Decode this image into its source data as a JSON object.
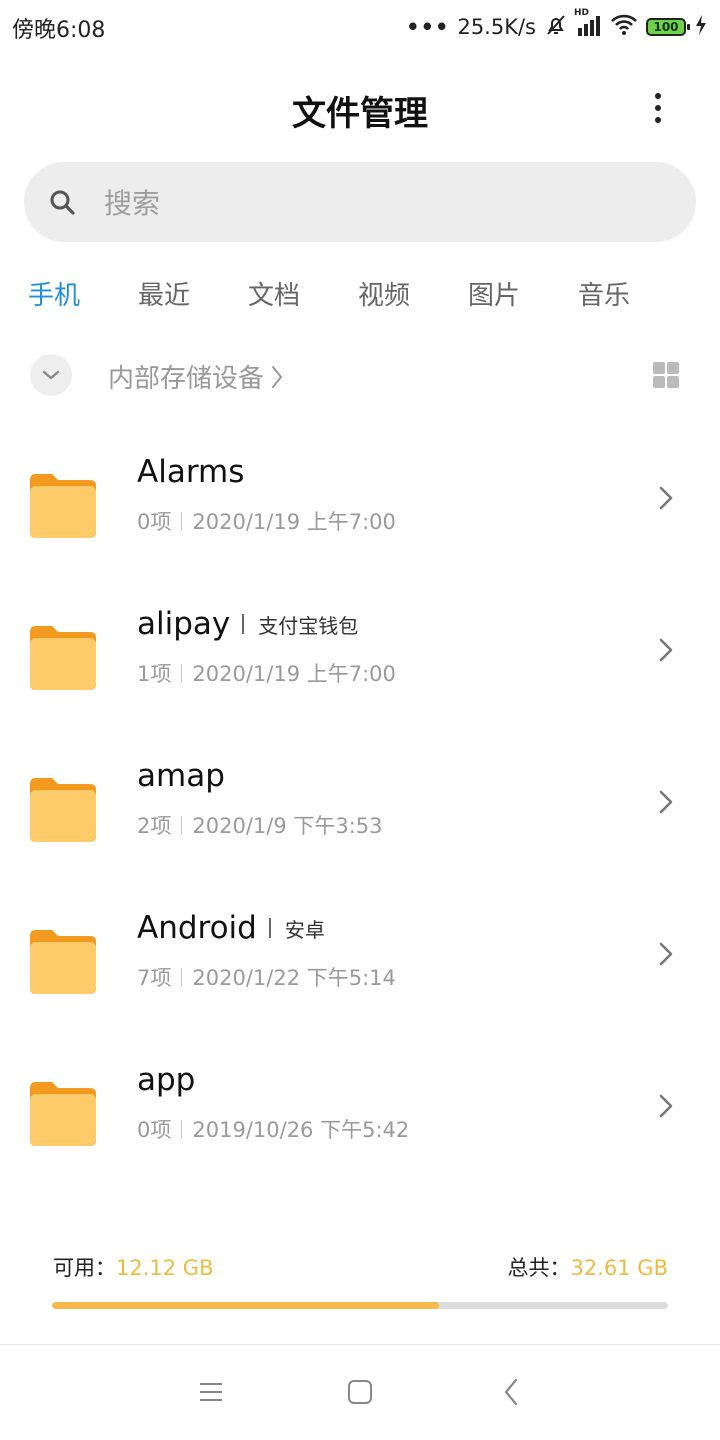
{
  "status_bar": {
    "time": "傍晚6:08",
    "network_speed": "25.5K/s",
    "network_type": "HD",
    "battery_level": "100",
    "icons": [
      "dots-icon",
      "mute-bell-icon",
      "signal-icon",
      "wifi-icon",
      "battery-icon",
      "charging-icon"
    ]
  },
  "header": {
    "title": "文件管理",
    "more_icon": "more-vertical-icon"
  },
  "search": {
    "placeholder": "搜索",
    "icon": "search-icon"
  },
  "tabs": [
    {
      "label": "手机",
      "active": true
    },
    {
      "label": "最近",
      "active": false
    },
    {
      "label": "文档",
      "active": false
    },
    {
      "label": "视频",
      "active": false
    },
    {
      "label": "图片",
      "active": false
    },
    {
      "label": "音乐",
      "active": false
    }
  ],
  "path_bar": {
    "location": "内部存储设备",
    "collapse_icon": "chevron-down-icon",
    "view_icon": "grid-view-icon"
  },
  "folders": [
    {
      "name": "Alarms",
      "alias": "",
      "items": "0项",
      "modified": "2020/1/19 上午7:00"
    },
    {
      "name": "alipay",
      "alias": "支付宝钱包",
      "items": "1项",
      "modified": "2020/1/19 上午7:00"
    },
    {
      "name": "amap",
      "alias": "",
      "items": "2项",
      "modified": "2020/1/9 下午3:53"
    },
    {
      "name": "Android",
      "alias": "安卓",
      "items": "7项",
      "modified": "2020/1/22 下午5:14"
    },
    {
      "name": "app",
      "alias": "",
      "items": "0项",
      "modified": "2019/10/26 下午5:42"
    }
  ],
  "storage": {
    "available_label": "可用：",
    "available_value": "12.12 GB",
    "total_label": "总共：",
    "total_value": "32.61 GB",
    "used_fraction": 0.6284,
    "accent_color": "#f6b94a"
  },
  "colors": {
    "active_tab": "#1e90dc",
    "folder": "#fecb6b",
    "folder_tab": "#f29a1f"
  },
  "nav_bar": {
    "icons": [
      "menu-icon",
      "home-icon",
      "back-icon"
    ]
  }
}
